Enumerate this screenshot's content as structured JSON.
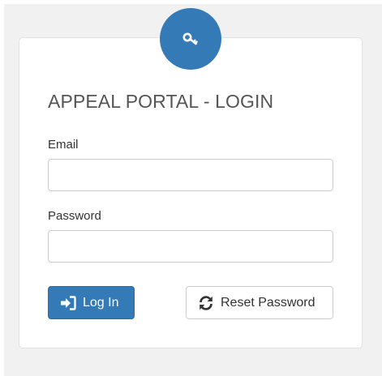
{
  "login": {
    "title": "APPEAL PORTAL - LOGIN",
    "email_label": "Email",
    "email_value": "",
    "password_label": "Password",
    "password_value": "",
    "login_button": "Log In",
    "reset_button": "Reset Password"
  },
  "icons": {
    "badge": "key-icon",
    "login": "sign-in-icon",
    "reset": "refresh-icon"
  },
  "colors": {
    "primary": "#337ab7",
    "backdrop": "#f1f1f1",
    "card_border": "#e2e2e2",
    "input_border": "#cccccc"
  }
}
